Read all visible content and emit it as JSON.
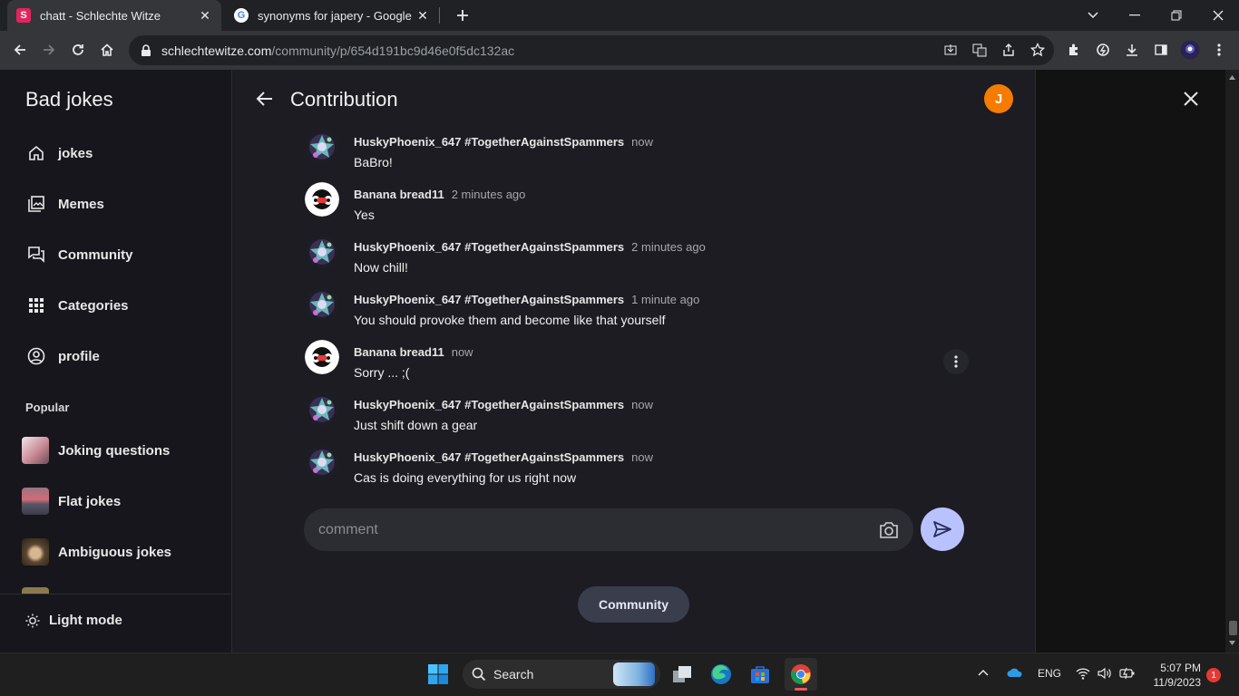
{
  "browser": {
    "tabs": [
      {
        "title": "chatt - Schlechte Witze",
        "favicon": "S",
        "favicon_color": "#e0245e",
        "active": true
      },
      {
        "title": "synonyms for japery - Google Se",
        "favicon": "G",
        "active": false
      }
    ],
    "url_host": "schlechtewitze.com",
    "url_path": "/community/p/654d191bc9d46e0f5dc132ac"
  },
  "sidebar": {
    "brand": "Bad jokes",
    "nav": [
      {
        "label": "jokes",
        "icon": "home-icon"
      },
      {
        "label": "Memes",
        "icon": "image-icon"
      },
      {
        "label": "Community",
        "icon": "chat-icon"
      },
      {
        "label": "Categories",
        "icon": "grid-icon"
      },
      {
        "label": "profile",
        "icon": "user-icon"
      }
    ],
    "popular_heading": "Popular",
    "popular": [
      {
        "label": "Joking questions"
      },
      {
        "label": "Flat jokes"
      },
      {
        "label": "Ambiguous jokes"
      }
    ],
    "light_mode": "Light mode"
  },
  "main": {
    "title": "Contribution",
    "user_initial": "J",
    "messages": [
      {
        "author": "HuskyPhoenix_647 #TogetherAgainstSpammers",
        "time": "now",
        "text": "BaBro!",
        "avatar": "husky"
      },
      {
        "author": "Banana bread11",
        "time": "2 minutes ago",
        "text": "Yes",
        "avatar": "banana"
      },
      {
        "author": "HuskyPhoenix_647 #TogetherAgainstSpammers",
        "time": "2 minutes ago",
        "text": "Now chill!",
        "avatar": "husky"
      },
      {
        "author": "HuskyPhoenix_647 #TogetherAgainstSpammers",
        "time": "1 minute ago",
        "text": "You should provoke them and become like that yourself",
        "avatar": "husky"
      },
      {
        "author": "Banana bread11",
        "time": "now",
        "text": "Sorry ... ;(",
        "avatar": "banana"
      },
      {
        "author": "HuskyPhoenix_647 #TogetherAgainstSpammers",
        "time": "now",
        "text": "Just shift down a gear",
        "avatar": "husky"
      },
      {
        "author": "HuskyPhoenix_647 #TogetherAgainstSpammers",
        "time": "now",
        "text": "Cas is doing everything for us right now",
        "avatar": "husky"
      }
    ],
    "comment_placeholder": "comment",
    "community_button": "Community"
  },
  "taskbar": {
    "search_label": "Search",
    "lang": "ENG",
    "time": "5:07 PM",
    "date": "11/9/2023",
    "notifications": "1"
  },
  "colors": {
    "accent_orange": "#f57c00",
    "send_button": "#b9c2ff",
    "background": "#1c1c22"
  }
}
